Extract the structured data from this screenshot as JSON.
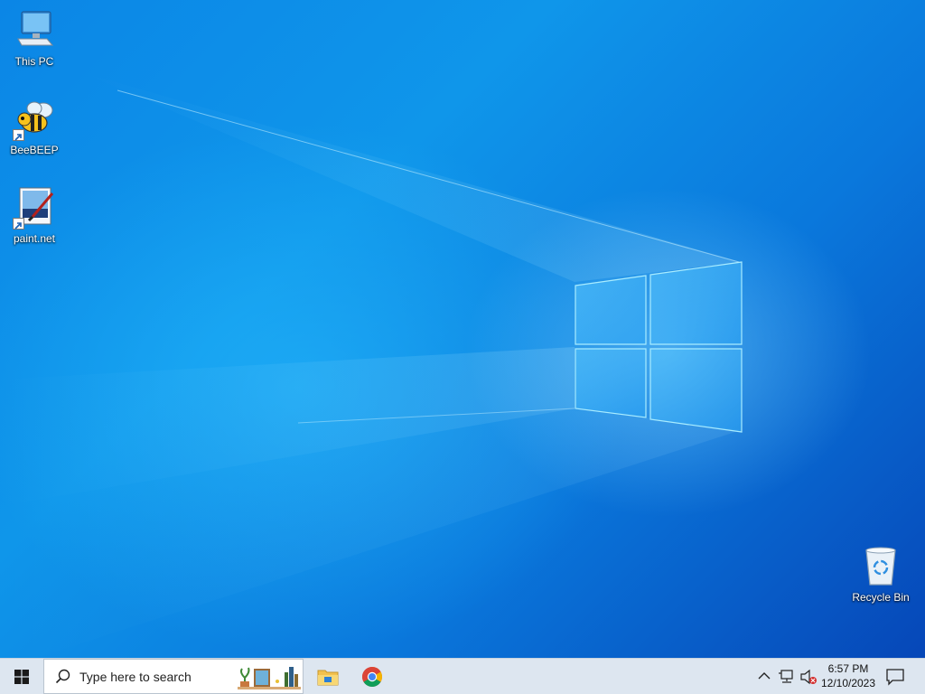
{
  "desktop": {
    "icons": [
      {
        "label": "This PC",
        "icon": "computer-monitor-icon"
      },
      {
        "label": "BeeBEEP",
        "icon": "bee-icon"
      },
      {
        "label": "paint.net",
        "icon": "paint-net-icon"
      },
      {
        "label": "Recycle Bin",
        "icon": "recycle-bin-icon"
      }
    ]
  },
  "taskbar": {
    "start_icon": "windows-logo-icon",
    "search": {
      "placeholder": "Type here to search",
      "icon": "magnifier-icon"
    },
    "pinned": [
      {
        "name": "File Explorer",
        "icon": "folder-icon"
      },
      {
        "name": "Google Chrome",
        "icon": "chrome-icon"
      }
    ],
    "tray": {
      "chevron_icon": "chevron-up-icon",
      "network_icon": "network-icon",
      "volume_icon": "volume-muted-icon",
      "time": "6:57 PM",
      "date": "12/10/2023",
      "notification_icon": "action-center-icon"
    }
  },
  "colors": {
    "wallpaper_blue": "#0a78dc",
    "taskbar_bg": "#dde6f0"
  }
}
